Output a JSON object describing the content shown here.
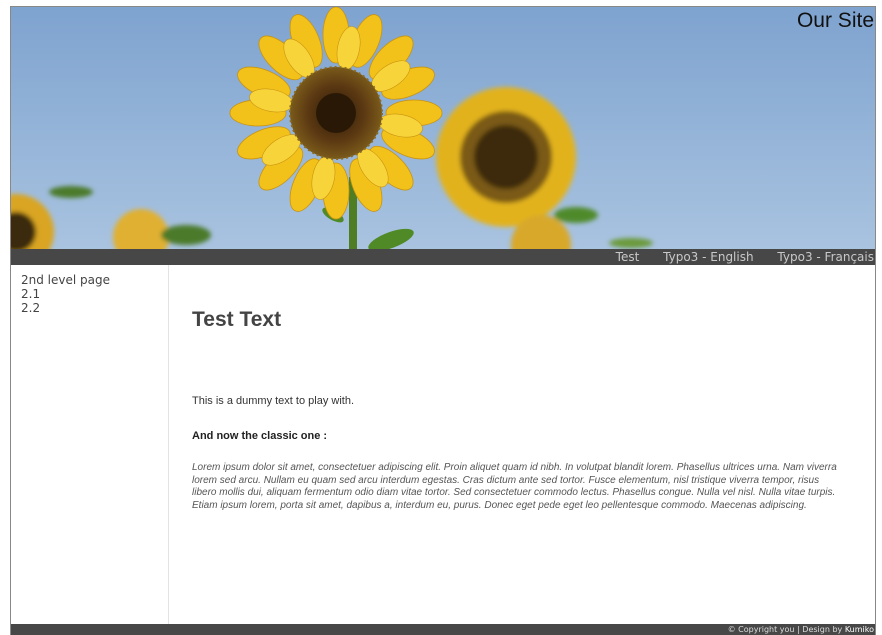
{
  "header": {
    "site_title": "Our Site"
  },
  "nav": {
    "items": [
      {
        "label": "Test"
      },
      {
        "label": "Typo3 - English"
      },
      {
        "label": "Typo3 - Français"
      }
    ]
  },
  "sidebar": {
    "items": [
      {
        "label": "2nd level page"
      },
      {
        "label": "2.1"
      },
      {
        "label": "2.2"
      }
    ]
  },
  "content": {
    "title": "Test Text",
    "intro": "This is a dummy text to play with.",
    "subheading": "And now the classic one :",
    "body": "Lorem ipsum dolor sit amet, consectetuer adipiscing elit. Proin aliquet quam id nibh. In volutpat blandit lorem. Phasellus ultrices urna. Nam viverra lorem sed arcu. Nullam eu quam sed arcu interdum egestas. Cras dictum ante sed tortor. Fusce elementum, nisl tristique viverra tempor, risus libero mollis dui, aliquam fermentum odio diam vitae tortor. Sed consectetuer commodo lectus. Phasellus congue. Nulla vel nisl. Nulla vitae turpis. Etiam ipsum lorem, porta sit amet, dapibus a, interdum eu, purus. Donec eget pede eget leo pellentesque commodo. Maecenas adipiscing."
  },
  "footer": {
    "copyright": "© Copyright you | Design by",
    "designer": "Kumiko"
  },
  "colors": {
    "sky": "#8fb1d6",
    "bar": "#474747",
    "petal": "#f2c21b",
    "center": "#5a3a14"
  }
}
